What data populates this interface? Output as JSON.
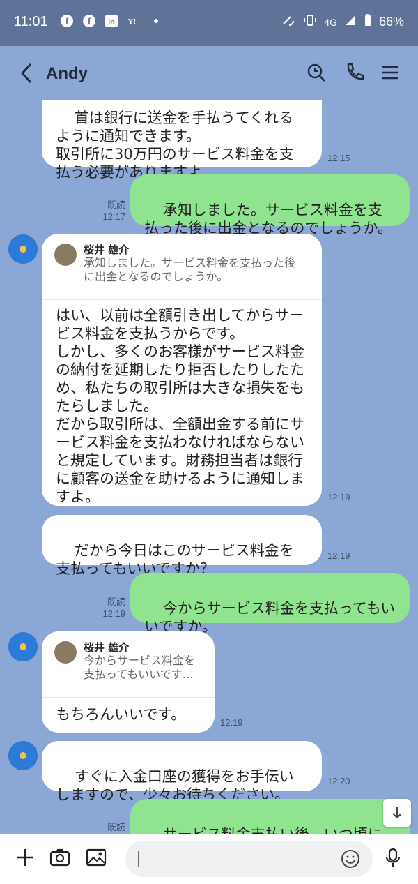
{
  "status": {
    "time": "11:01",
    "network": "4G",
    "battery": "66%"
  },
  "header": {
    "title": "Andy"
  },
  "messages": [
    {
      "text": "首は銀行に送金を手払うてくれるように通知できます。\n取引所に30万円のサービス料金を支払う必要がありますよ。",
      "time": "12:15"
    },
    {
      "text": "承知しました。サービス料金を支払った後に出金となるのでしょうか。",
      "time": "12:17",
      "read": "既読"
    },
    {
      "quote_name": "桜井 雄介",
      "quote_text": "承知しました。サービス料金を支払った後\nに出金となるのでしょうか。",
      "text": "はい、以前は全額引き出してからサービス料金を支払うからです。\nしかし、多くのお客様がサービス料金の納付を延期したり拒否したりしたため、私たちの取引所は大きな損失をもたらしました。\nだから取引所は、全額出金する前にサービス料金を支払わなければならないと規定しています。財務担当者は銀行に顧客の送金を助けるように通知しますよ。",
      "time": "12:19"
    },
    {
      "text": "だから今日はこのサービス料金を支払ってもいいですか？",
      "time": "12:19"
    },
    {
      "text": "今からサービス料金を支払ってもいいですか。",
      "time": "12:19",
      "read": "既読"
    },
    {
      "quote_name": "桜井 雄介",
      "quote_text": "今からサービス料金を\n支払ってもいいです…",
      "text": "もちろんいいです。",
      "time": "12:19"
    },
    {
      "text": "すぐに入金口座の獲得をお手伝いしますので、少々お待ちください。",
      "time": "12:20"
    },
    {
      "text": "サービス料金支払い後、いつ頃に出金が完了しますか？",
      "read": "既読"
    }
  ],
  "colors": {
    "chat_bg": "#8aa7d6",
    "header_bg": "#5f7297",
    "green_bubble": "#91e48f",
    "white_bubble": "#ffffff"
  },
  "icons": {
    "back": "chevron-left-icon",
    "search": "search-icon",
    "call": "phone-icon",
    "menu": "menu-icon",
    "plus": "plus-icon",
    "camera": "camera-icon",
    "image": "image-icon",
    "emoji": "emoji-icon",
    "mic": "microphone-icon",
    "scroll": "arrow-down-icon"
  }
}
